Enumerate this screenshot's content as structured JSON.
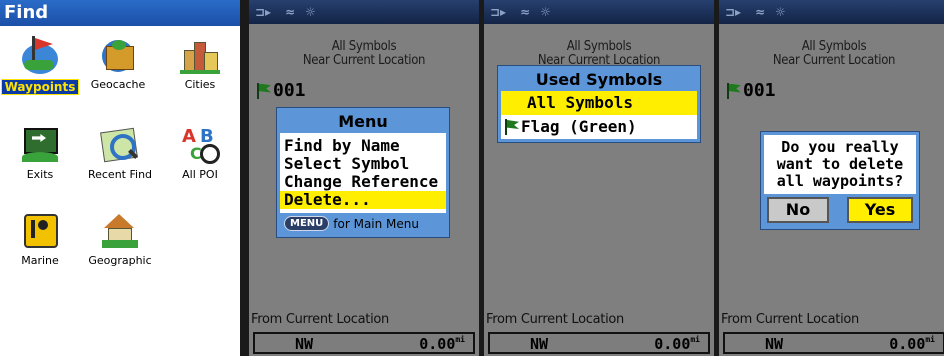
{
  "find": {
    "title": "Find",
    "items": [
      {
        "label": "Waypoints",
        "icon": "waypoints-icon",
        "selected": true
      },
      {
        "label": "Geocache",
        "icon": "geocache-icon"
      },
      {
        "label": "Cities",
        "icon": "cities-icon"
      },
      {
        "label": "Exits",
        "icon": "exits-icon"
      },
      {
        "label": "Recent Find",
        "icon": "recent-find-icon"
      },
      {
        "label": "All POI",
        "icon": "all-poi-icon"
      },
      {
        "label": "Marine",
        "icon": "marine-icon"
      },
      {
        "label": "Geographic",
        "icon": "geographic-icon"
      }
    ]
  },
  "screen_header": {
    "line1": "All Symbols",
    "line2": "Near Current Location"
  },
  "waypoint": {
    "name": "001"
  },
  "footer": {
    "label": "From Current Location",
    "direction": "NW",
    "distance": "0.00",
    "unit": "mi"
  },
  "menu": {
    "title": "Menu",
    "items": [
      "Find by Name",
      "Select Symbol",
      "Change Reference",
      "Delete..."
    ],
    "highlighted_index": 3,
    "hint_key": "MENU",
    "hint_text": "for Main Menu"
  },
  "used_symbols": {
    "title": "Used Symbols",
    "items": [
      "All Symbols",
      "Flag (Green)"
    ],
    "highlighted_index": 0
  },
  "confirm": {
    "message_lines": [
      "Do you really",
      "want to delete",
      "all waypoints?"
    ],
    "no_label": "No",
    "yes_label": "Yes"
  },
  "colors": {
    "accent_yellow": "#ffee00",
    "dialog_border": "#5c95d8",
    "screen_gray": "#7f7f7f",
    "title_blue": "#1b4fa8"
  }
}
